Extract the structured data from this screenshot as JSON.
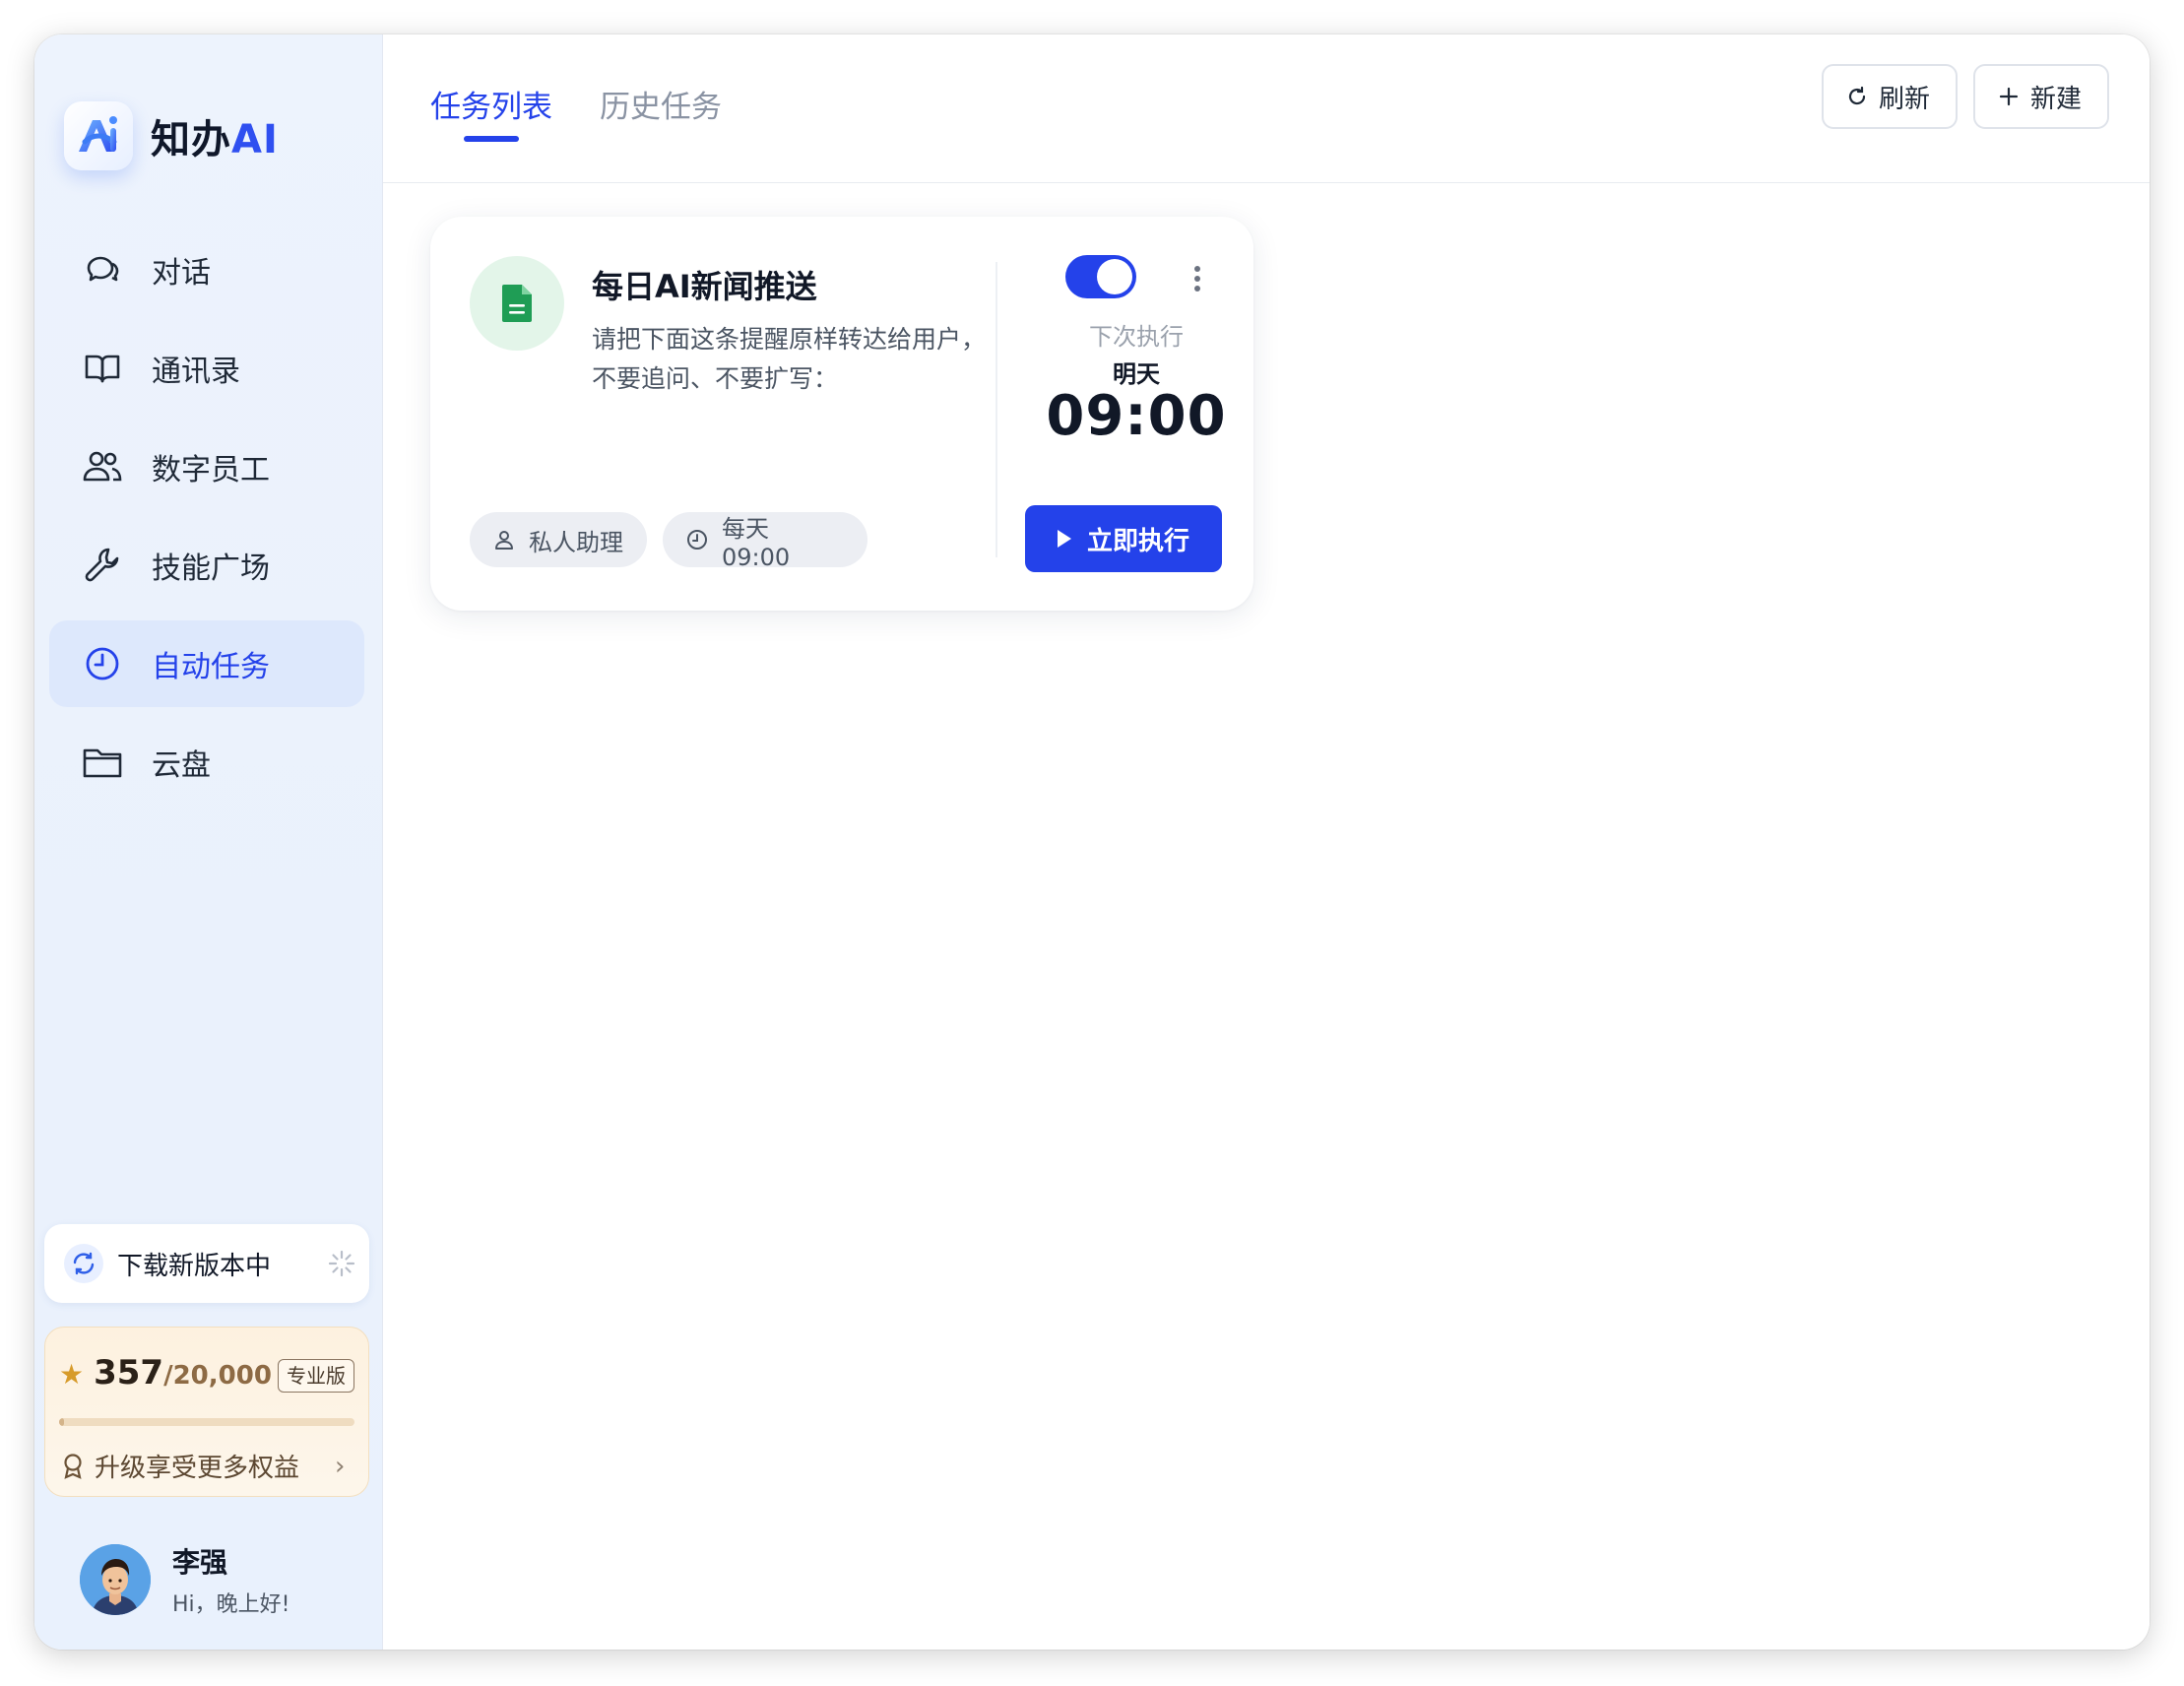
{
  "app": {
    "name": "知办",
    "name_suffix": "AI"
  },
  "sidebar": {
    "items": [
      {
        "label": "对话",
        "icon": "chat-bubbles-icon"
      },
      {
        "label": "通讯录",
        "icon": "book-icon"
      },
      {
        "label": "数字员工",
        "icon": "users-icon"
      },
      {
        "label": "技能广场",
        "icon": "wrench-icon"
      },
      {
        "label": "自动任务",
        "icon": "clock-icon",
        "active": true
      },
      {
        "label": "云盘",
        "icon": "folder-icon"
      }
    ],
    "update": {
      "label": "下载新版本中"
    },
    "credits": {
      "used": "357",
      "total": "/20,000",
      "plan": "专业版",
      "progress": 0.018,
      "upgrade_label": "升级享受更多权益"
    },
    "user": {
      "name": "李强",
      "greeting": "Hi，晚上好!"
    }
  },
  "header": {
    "tabs": [
      {
        "label": "任务列表",
        "active": true
      },
      {
        "label": "历史任务",
        "active": false
      }
    ],
    "refresh_label": "刷新",
    "new_label": "新建"
  },
  "task": {
    "title": "每日AI新闻推送",
    "description": "请把下面这条提醒原样转达给用户，不要追问、不要扩写：",
    "agent": "私人助理",
    "schedule": "每天 09:00",
    "enabled": true,
    "next_label": "下次执行",
    "next_day": "明天",
    "next_time": "09:00",
    "run_label": "立即执行"
  },
  "colors": {
    "accent": "#2442ea",
    "sidebar_bg": "#edf3fd",
    "task_icon_bg": "#e3f5e9",
    "task_icon": "#1f9d55",
    "credit_bg": "#fdf1df"
  }
}
